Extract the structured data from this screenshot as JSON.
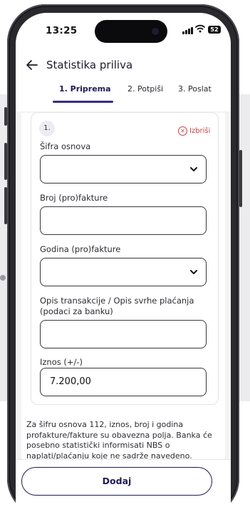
{
  "status_bar": {
    "time": "13:25",
    "battery": "52"
  },
  "header": {
    "title": "Statistika priliva"
  },
  "tabs": [
    {
      "label": "1. Priprema",
      "active": true
    },
    {
      "label": "2. Potpiši",
      "active": false
    },
    {
      "label": "3. Poslat",
      "active": false
    }
  ],
  "entry": {
    "number": "1.",
    "delete_label": "Izbriši",
    "fields": [
      {
        "label": "Šifra osnova",
        "value": "",
        "type": "select"
      },
      {
        "label": "Broj (pro)fakture",
        "value": "",
        "type": "text"
      },
      {
        "label": "Godina (pro)fakture",
        "value": "",
        "type": "select"
      },
      {
        "label": "Opis transakcije / Opis svrhe plaćanja (podaci za banku)",
        "value": "",
        "type": "text"
      },
      {
        "label": "Iznos (+/-)",
        "value": "7.200,00",
        "type": "text"
      }
    ]
  },
  "note": "Za šifru osnova 112, iznos, broj i godina profakture/fakture su obavezna polja. Banka će posebno statistički informisati NBS o naplati/plaćanju koje ne sadrže navedeno.",
  "footer": {
    "add_label": "Dodaj"
  },
  "colors": {
    "accent": "#1e1a5c",
    "tab_underline": "#3a2a8c",
    "danger": "#e23b3b"
  }
}
